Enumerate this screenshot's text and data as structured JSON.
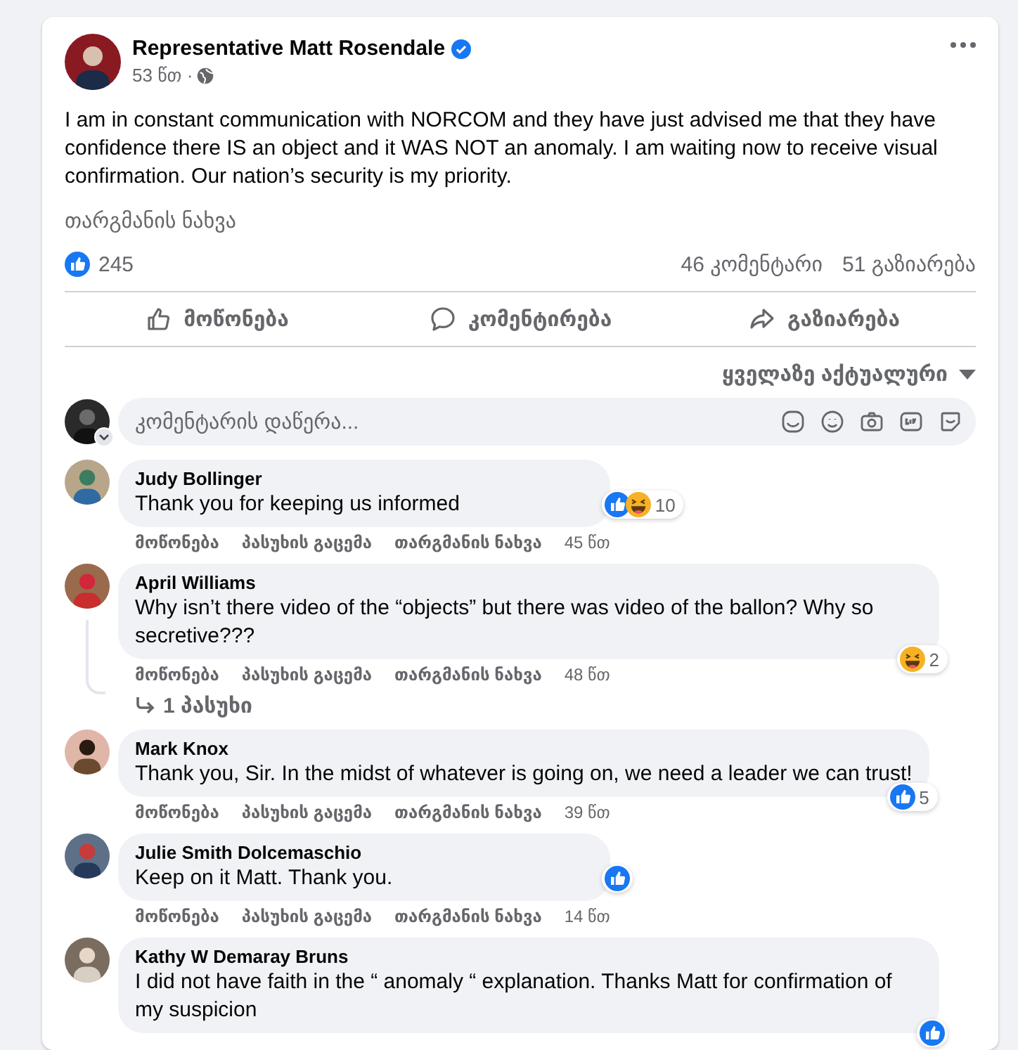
{
  "post": {
    "author": "Representative Matt Rosendale",
    "verified": true,
    "time": "53 წთ ·",
    "text": "I am in constant communication with NORCOM and they have just advised me that they have confidence there IS an object and it WAS NOT an anomaly. I am waiting now to receive visual confirmation. Our nation’s security is my priority.",
    "translate": "თარგმანის ნახვა",
    "likes": "245",
    "comments": "46 კომენტარი",
    "shares": "51 გაზიარება",
    "actions": [
      {
        "kind": "like",
        "label": "მოწონება"
      },
      {
        "kind": "comment",
        "label": "კომენტირება"
      },
      {
        "kind": "share",
        "label": "გაზიარება"
      }
    ]
  },
  "sort": {
    "label": "ყველაზე აქტუალური"
  },
  "composer": {
    "placeholder": "კომენტარის დაწერა..."
  },
  "comments": [
    {
      "name": "Judy Bollinger",
      "text": "Thank you for keeping us informed",
      "reactions": [
        {
          "kind": "like"
        },
        {
          "kind": "haha"
        }
      ],
      "reaction_count": "10",
      "actions": [
        "მოწონება",
        "პასუხის გაცემა",
        "თარგმანის ნახვა"
      ],
      "time": "45 წთ"
    },
    {
      "name": "April Williams",
      "text": "Why isn’t there video of the “objects” but there was video of the ballon? Why so secretive???",
      "reactions": [
        {
          "kind": "haha"
        }
      ],
      "reaction_count": "2",
      "actions": [
        "მოწონება",
        "პასუხის გაცემა",
        "თარგმანის ნახვა"
      ],
      "time": "48 წთ",
      "replies": "1 პასუხი"
    },
    {
      "name": "Mark Knox",
      "text": "Thank you, Sir. In the midst of whatever is going on, we need a leader we can trust!",
      "reactions": [
        {
          "kind": "like"
        }
      ],
      "reaction_count": "5",
      "actions": [
        "მოწონება",
        "პასუხის გაცემა",
        "თარგმანის ნახვა"
      ],
      "time": "39 წთ"
    },
    {
      "name": "Julie Smith Dolcemaschio",
      "text": "Keep on it Matt. Thank you.",
      "reactions": [
        {
          "kind": "like"
        }
      ],
      "actions": [
        "მოწონება",
        "პასუხის გაცემა",
        "თარგმანის ნახვა"
      ],
      "time": "14 წთ"
    },
    {
      "name": "Kathy W Demaray Bruns",
      "text": "I did not have faith in the “ anomaly “ explanation. Thanks Matt for confirmation of my suspicion",
      "reactions": [
        {
          "kind": "like"
        }
      ]
    }
  ]
}
